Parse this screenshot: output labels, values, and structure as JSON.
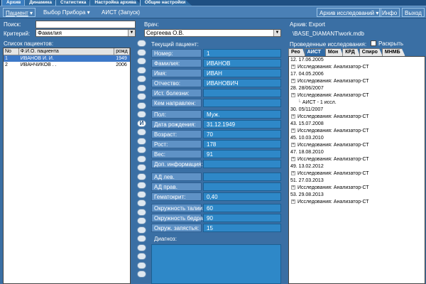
{
  "tabs": [
    "Архив",
    "Динамика",
    "Статистика",
    "Настройка архива",
    "Общие настройки"
  ],
  "toolbar": {
    "patient": "Пациент",
    "device": "Выбор Прибора",
    "aist": "АИСТ (Запуск)",
    "archive_menu": "Архив исследований",
    "info": "Инфо",
    "exit": "Выход"
  },
  "search": {
    "label": "Поиск:",
    "value": "",
    "criterion_label": "Критерий:",
    "criterion_value": "Фамилия"
  },
  "doctor": {
    "label": "Врач:",
    "value": "Сергеева О.В."
  },
  "archive": {
    "label": "Архив:",
    "name": "Export",
    "path": "\\BASE_DIAMANT\\work.mdb"
  },
  "patients": {
    "title": "Список пациентов:",
    "columns": [
      "No",
      "Ф.И.О. пациента",
      "рожд"
    ],
    "rows": [
      [
        "1",
        "ИВАНОВ И. И.",
        "1949"
      ],
      [
        "2",
        "ИВАНЧИКОВ  .  .",
        "2006"
      ]
    ]
  },
  "current": {
    "title": "Текущий пациент:",
    "fields": [
      {
        "label": "Номер:",
        "value": "1"
      },
      {
        "label": "Фамилия:",
        "value": "ИВАНОВ"
      },
      {
        "label": "Имя:",
        "value": "ИВАН"
      },
      {
        "label": "Отчество:",
        "value": "ИВАНОВИЧ"
      },
      {
        "label": "Ист. болезни:",
        "value": ""
      },
      {
        "label": "Кем направлен:",
        "value": ""
      },
      {
        "label": "Пол:",
        "value": "Муж."
      },
      {
        "label": "Дата рождения:",
        "value": "31.12.1949"
      },
      {
        "label": "Возраст:",
        "value": "70"
      },
      {
        "label": "Рост:",
        "value": "178"
      },
      {
        "label": "Вес:",
        "value": "91"
      },
      {
        "label": "Доп. информация:",
        "value": ""
      },
      {
        "label": "АД лев.",
        "value": ""
      },
      {
        "label": "АД прав.",
        "value": ""
      },
      {
        "label": "Гематокрит:",
        "value": "0,40"
      },
      {
        "label": "Окружность талии:",
        "value": "60"
      },
      {
        "label": "Окружность бедра:",
        "value": "90"
      },
      {
        "label": "Окруж. запястья:",
        "value": "15"
      }
    ],
    "diagnosis_label": "Диагноз:"
  },
  "studies": {
    "title": "Проведенные исследования:",
    "expand_label": "Раскрыть",
    "tabs": [
      "Рео",
      "АИСТ",
      "Мон",
      "КРД",
      "Спиро",
      "МНМБ"
    ],
    "active_tab": "АИСТ",
    "items": [
      {
        "t": "date",
        "text": "12. 17.06.2005"
      },
      {
        "t": "item",
        "text": "Исследования: Анализатор-СТ"
      },
      {
        "t": "date",
        "text": "17. 04.05.2006"
      },
      {
        "t": "item",
        "text": "Исследования: Анализатор-СТ"
      },
      {
        "t": "date",
        "text": "28. 28/06/2007"
      },
      {
        "t": "item",
        "text": "Исследования: Анализатор-СТ"
      },
      {
        "t": "sub",
        "text": "АИСТ - 1 иссл."
      },
      {
        "t": "date",
        "text": "30. 05/11/2007"
      },
      {
        "t": "item",
        "text": "Исследования: Анализатор-СТ"
      },
      {
        "t": "date",
        "text": "43. 15.07.2008"
      },
      {
        "t": "item",
        "text": "Исследования: Анализатор-СТ"
      },
      {
        "t": "date",
        "text": "45. 10.03.2010"
      },
      {
        "t": "item",
        "text": "Исследования: Анализатор-СТ"
      },
      {
        "t": "date",
        "text": "47. 18.08.2010"
      },
      {
        "t": "item",
        "text": "Исследования: Анализатор-СТ"
      },
      {
        "t": "date",
        "text": "49. 13.02.2012"
      },
      {
        "t": "item",
        "text": "Исследования: Анализатор-СТ"
      },
      {
        "t": "date",
        "text": "51. 27.03.2013"
      },
      {
        "t": "item",
        "text": "Исследования: Анализатор-СТ"
      },
      {
        "t": "date",
        "text": "53. 29.08.2013"
      },
      {
        "t": "item",
        "text": "Исследования: Анализатор-СТ"
      }
    ]
  },
  "side_strip_label": "И"
}
